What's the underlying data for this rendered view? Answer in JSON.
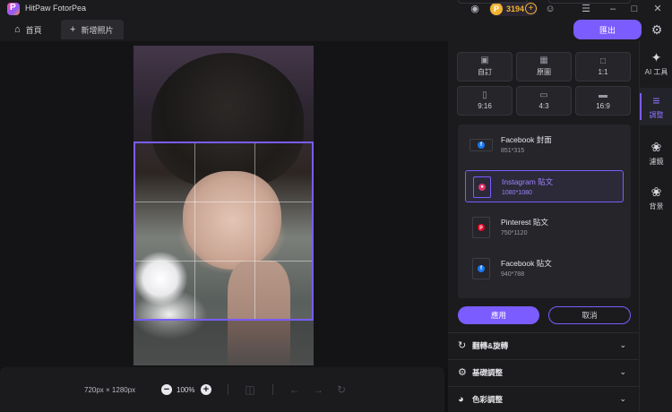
{
  "app": {
    "title": "HitPaw FotorPea"
  },
  "titlebar": {
    "coins": "3194",
    "icons": [
      "discord-icon",
      "coin-icon",
      "add-coins-icon",
      "account-icon",
      "menu-icon",
      "minimize-icon",
      "maximize-icon",
      "close-icon"
    ]
  },
  "tabs": {
    "home": "首頁",
    "new_photo": "新增照片"
  },
  "toolbar": {
    "export": "匯出"
  },
  "canvas": {
    "image_size": "720px × 1280px",
    "zoom": "100%"
  },
  "ratios": [
    {
      "label": "自訂",
      "icon": "crop-free-icon"
    },
    {
      "label": "原圖",
      "icon": "image-icon"
    },
    {
      "label": "1:1",
      "icon": "square-icon"
    },
    {
      "label": "9:16",
      "icon": "portrait-icon"
    },
    {
      "label": "4:3",
      "icon": "landscape-icon"
    },
    {
      "label": "16:9",
      "icon": "wide-icon"
    }
  ],
  "presets": [
    {
      "name": "Facebook 封面",
      "size": "851*315",
      "selected": false,
      "color": "#1877f2"
    },
    {
      "name": "Instagram 貼文",
      "size": "1080*1080",
      "selected": true,
      "color": "#e1306c"
    },
    {
      "name": "Pinterest 貼文",
      "size": "750*1120",
      "selected": false,
      "color": "#e60023"
    },
    {
      "name": "Facebook 貼文",
      "size": "940*788",
      "selected": false,
      "color": "#1877f2"
    }
  ],
  "actions": {
    "apply": "應用",
    "cancel": "取消"
  },
  "sections": [
    {
      "label": "翻轉&旋轉",
      "icon": "rotate-icon"
    },
    {
      "label": "基礎調整",
      "icon": "sliders-icon"
    },
    {
      "label": "色彩調整",
      "icon": "palette-icon"
    }
  ],
  "rail": [
    {
      "label": "AI 工具",
      "icon": "ai-tools-icon",
      "active": false
    },
    {
      "label": "調整",
      "icon": "adjust-icon",
      "active": true
    },
    {
      "label": "濾鏡",
      "icon": "filter-icon",
      "active": false
    },
    {
      "label": "背景",
      "icon": "background-icon",
      "active": false
    }
  ],
  "colors": {
    "accent": "#7b5cff",
    "coin": "#f1b431",
    "panel_bg": "#1b1b1e"
  }
}
